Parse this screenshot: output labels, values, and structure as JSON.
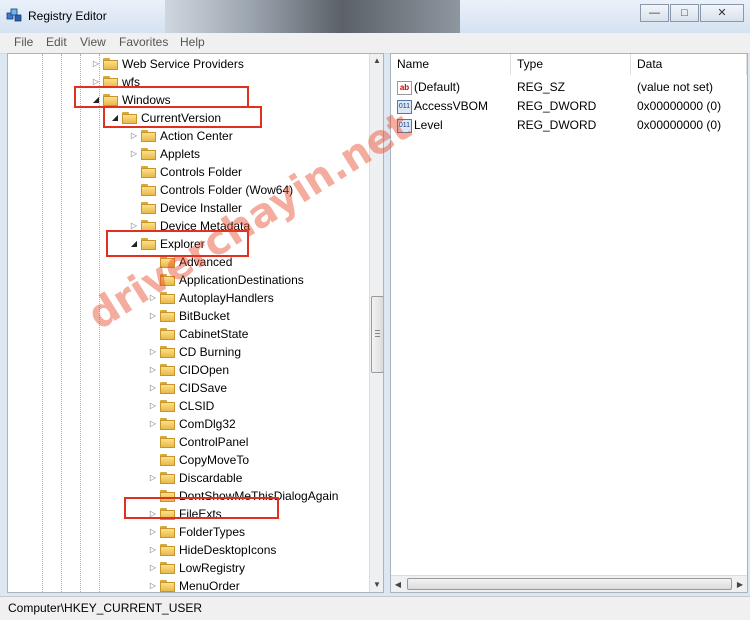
{
  "window": {
    "title": "Registry Editor",
    "icons": {
      "app": "registry-editor-icon",
      "minimize": "minimize-icon",
      "maximize": "maximize-icon",
      "close": "close-icon"
    }
  },
  "menu": [
    "File",
    "Edit",
    "View",
    "Favorites",
    "Help"
  ],
  "tree": [
    {
      "label": "Web Service Providers",
      "expander": "collapsed"
    },
    {
      "label": "wfs",
      "expander": "collapsed"
    },
    {
      "label": "Windows",
      "expander": "expanded"
    },
    {
      "label": "CurrentVersion",
      "expander": "expanded"
    },
    {
      "label": "Action Center",
      "expander": "collapsed"
    },
    {
      "label": "Applets",
      "expander": "collapsed"
    },
    {
      "label": "Controls Folder",
      "expander": "none"
    },
    {
      "label": "Controls Folder (Wow64)",
      "expander": "none"
    },
    {
      "label": "Device Installer",
      "expander": "none"
    },
    {
      "label": "Device Metadata",
      "expander": "collapsed"
    },
    {
      "label": "Explorer",
      "expander": "expanded"
    },
    {
      "label": "Advanced",
      "expander": "none"
    },
    {
      "label": "ApplicationDestinations",
      "expander": "none"
    },
    {
      "label": "AutoplayHandlers",
      "expander": "collapsed"
    },
    {
      "label": "BitBucket",
      "expander": "collapsed"
    },
    {
      "label": "CabinetState",
      "expander": "none"
    },
    {
      "label": "CD Burning",
      "expander": "collapsed"
    },
    {
      "label": "CIDOpen",
      "expander": "collapsed"
    },
    {
      "label": "CIDSave",
      "expander": "collapsed"
    },
    {
      "label": "CLSID",
      "expander": "collapsed"
    },
    {
      "label": "ComDlg32",
      "expander": "collapsed"
    },
    {
      "label": "ControlPanel",
      "expander": "none"
    },
    {
      "label": "CopyMoveTo",
      "expander": "none"
    },
    {
      "label": "Discardable",
      "expander": "collapsed"
    },
    {
      "label": "DontShowMeThisDialogAgain",
      "expander": "none"
    },
    {
      "label": "FileExts",
      "expander": "collapsed"
    },
    {
      "label": "FolderTypes",
      "expander": "collapsed"
    },
    {
      "label": "HideDesktopIcons",
      "expander": "collapsed"
    },
    {
      "label": "LowRegistry",
      "expander": "collapsed"
    },
    {
      "label": "MenuOrder",
      "expander": "collapsed"
    }
  ],
  "columns": {
    "name": "Name",
    "type": "Type",
    "data": "Data"
  },
  "values": [
    {
      "icon": "string-value-icon",
      "badge": "ab",
      "name": "(Default)",
      "type": "REG_SZ",
      "data": "(value not set)"
    },
    {
      "icon": "dword-value-icon",
      "badge": "011",
      "name": "AccessVBOM",
      "type": "REG_DWORD",
      "data": "0x00000000 (0)"
    },
    {
      "icon": "dword-value-icon",
      "badge": "011",
      "name": "Level",
      "type": "REG_DWORD",
      "data": "0x00000000 (0)"
    }
  ],
  "status": {
    "path": "Computer\\HKEY_CURRENT_USER"
  },
  "watermark": "driverchayin.net",
  "colors": {
    "highlight": "#e03020",
    "folder": "#e9b94a",
    "watermark": "#e64628"
  }
}
